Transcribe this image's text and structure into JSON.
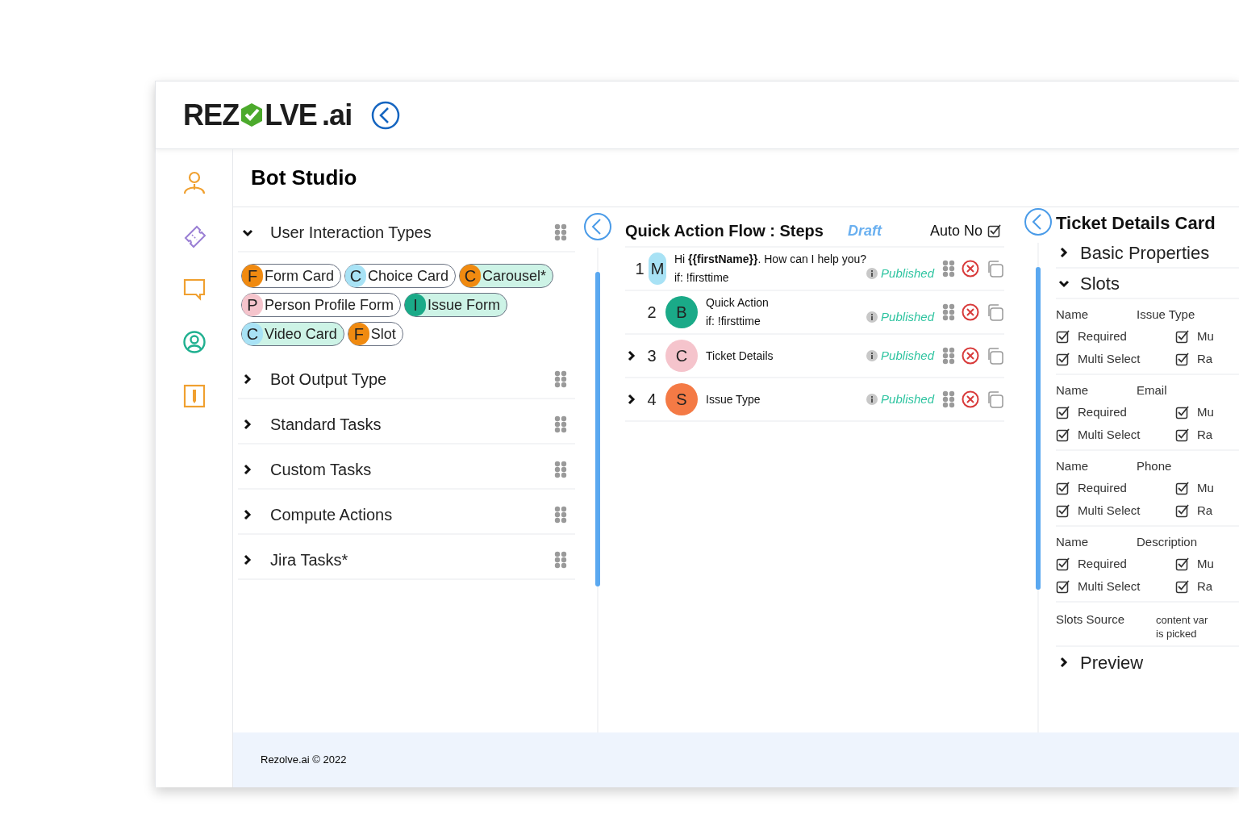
{
  "header": {
    "logo_text_1": "REZ",
    "logo_text_2": "LVE",
    "logo_text_3": ".ai"
  },
  "sidebar": {
    "items": [
      {
        "kind": "person",
        "color": "#f0a030"
      },
      {
        "kind": "ticket",
        "color": "#9a7fd4"
      },
      {
        "kind": "chat",
        "color": "#f0a030"
      },
      {
        "kind": "user",
        "color": "#20b090"
      },
      {
        "kind": "badge",
        "color": "#f0a030"
      }
    ]
  },
  "page_title": "Bot Studio",
  "palette": {
    "sections": [
      {
        "label": "User Interaction Types",
        "expanded": true,
        "chips": [
          {
            "letter": "F",
            "label": "Form Card",
            "color": "#f08a10",
            "selected": false
          },
          {
            "letter": "C",
            "label": "Choice Card",
            "color": "#a8e2f5",
            "selected": false
          },
          {
            "letter": "C",
            "label": "Carousel*",
            "color": "#f08a10",
            "selected": true
          },
          {
            "letter": "P",
            "label": "Person Profile Form",
            "color": "#f5c4cc",
            "selected": false
          },
          {
            "letter": "I",
            "label": "Issue Form",
            "color": "#1aaa88",
            "selected": true
          },
          {
            "letter": "C",
            "label": "Video Card",
            "color": "#a8e2f5",
            "selected": true
          },
          {
            "letter": "F",
            "label": "Slot",
            "color": "#f08a10",
            "selected": false
          }
        ]
      },
      {
        "label": "Bot Output Type",
        "expanded": false
      },
      {
        "label": "Standard Tasks",
        "expanded": false
      },
      {
        "label": "Custom Tasks",
        "expanded": false
      },
      {
        "label": "Compute Actions",
        "expanded": false
      },
      {
        "label": "Jira Tasks*",
        "expanded": false
      }
    ]
  },
  "flow": {
    "title": "Quick Action Flow : Steps",
    "status": "Draft",
    "auto_no": {
      "label": "Auto No",
      "checked": true
    },
    "steps": [
      {
        "number": "1",
        "letter": "M",
        "color": "#a8e2f5",
        "title": "Hi **{{firstName}}**. How can I help you?",
        "condition": "if: !firsttime",
        "status": "Published",
        "expandable": false
      },
      {
        "number": "2",
        "letter": "B",
        "color": "#1aaa88",
        "title": "Quick Action",
        "condition": "if: !firsttime",
        "status": "Published",
        "expandable": false
      },
      {
        "number": "3",
        "letter": "C",
        "color": "#f5c4cc",
        "title": "Ticket Details",
        "status": "Published",
        "expandable": true
      },
      {
        "number": "4",
        "letter": "S",
        "color": "#f47a45",
        "title": "Issue Type",
        "status": "Published",
        "expandable": true
      }
    ]
  },
  "details": {
    "title": "Ticket Details Card",
    "sections_top": [
      {
        "label": "Basic Properties",
        "expanded": false
      },
      {
        "label": "Slots",
        "expanded": true
      }
    ],
    "slots": [
      {
        "name_label": "Name",
        "value": "Issue Type",
        "options": [
          {
            "label": "Required",
            "checked": true
          },
          {
            "label": "Mu",
            "checked": true
          },
          {
            "label": "Multi Select",
            "checked": true
          },
          {
            "label": "Ra",
            "checked": true
          }
        ]
      },
      {
        "name_label": "Name",
        "value": "Email",
        "options": [
          {
            "label": "Required",
            "checked": true
          },
          {
            "label": "Mu",
            "checked": true
          },
          {
            "label": "Multi Select",
            "checked": true
          },
          {
            "label": "Ra",
            "checked": true
          }
        ]
      },
      {
        "name_label": "Name",
        "value": "Phone",
        "options": [
          {
            "label": "Required",
            "checked": true
          },
          {
            "label": "Mu",
            "checked": true
          },
          {
            "label": "Multi Select",
            "checked": true
          },
          {
            "label": "Ra",
            "checked": true
          }
        ]
      },
      {
        "name_label": "Name",
        "value": "Description",
        "options": [
          {
            "label": "Required",
            "checked": true
          },
          {
            "label": "Mu",
            "checked": true
          },
          {
            "label": "Multi Select",
            "checked": true
          },
          {
            "label": "Ra",
            "checked": true
          }
        ]
      }
    ],
    "slots_source": {
      "label": "Slots Source",
      "value": "content var\nis picked"
    },
    "sections_bottom": [
      {
        "label": "Preview",
        "expanded": false
      }
    ]
  },
  "footer": "Rezolve.ai © 2022"
}
